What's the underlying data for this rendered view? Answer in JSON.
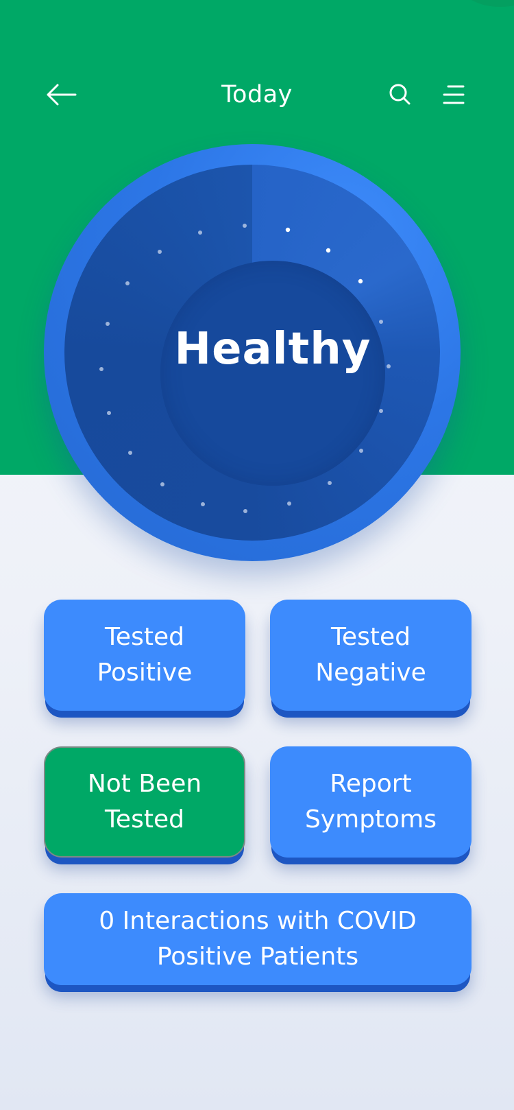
{
  "header": {
    "title": "Today",
    "back_icon": "arrow-left-icon",
    "search_icon": "search-icon",
    "menu_icon": "menu-icon"
  },
  "status": {
    "label": "Healthy"
  },
  "buttons": {
    "tested_positive": "Tested Positive",
    "tested_negative": "Tested Negative",
    "not_been_tested": "Not Been Tested",
    "report_symptoms": "Report Symptoms",
    "interactions": "0 Interactions with COVID Positive Patients"
  },
  "colors": {
    "header_green": "#00a866",
    "button_blue": "#3d8bfd",
    "dial_blue": "#16499c"
  }
}
